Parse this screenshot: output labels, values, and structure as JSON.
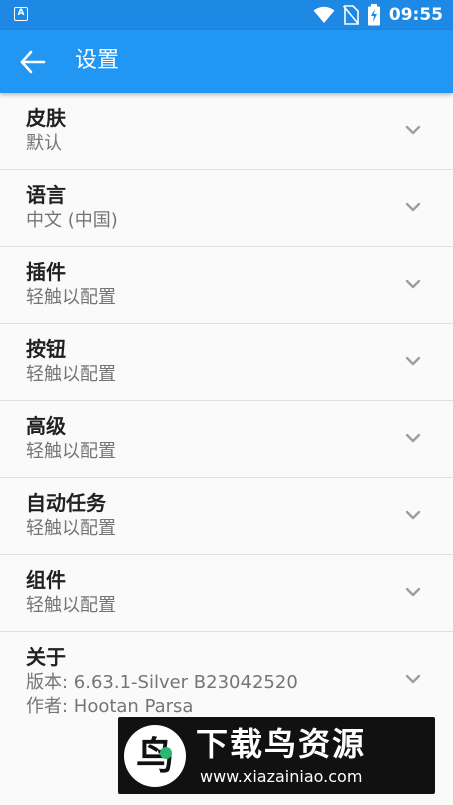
{
  "status_bar": {
    "app_badge": "A",
    "time": "09:55",
    "icons": [
      "wifi-icon",
      "no-sim-icon",
      "battery-charging-icon"
    ]
  },
  "app_bar": {
    "title": "设置",
    "back_icon": "arrow-left-icon"
  },
  "settings": {
    "items": [
      {
        "title": "皮肤",
        "subtitle": "默认"
      },
      {
        "title": "语言",
        "subtitle": "中文 (中国)"
      },
      {
        "title": "插件",
        "subtitle": "轻触以配置"
      },
      {
        "title": "按钮",
        "subtitle": "轻触以配置"
      },
      {
        "title": "高级",
        "subtitle": "轻触以配置"
      },
      {
        "title": "自动任务",
        "subtitle": "轻触以配置"
      },
      {
        "title": "组件",
        "subtitle": "轻触以配置"
      }
    ],
    "about": {
      "title": "关于",
      "version": "版本: 6.63.1-Silver  B23042520",
      "author": "作者: Hootan Parsa"
    },
    "expand_icon": "chevron-down-icon"
  },
  "watermark": {
    "logo_glyph": "鸟",
    "title": "下载鸟资源",
    "url": "www.xiazainiao.com"
  },
  "colors": {
    "status_bar": "#1e88e5",
    "app_bar": "#2196f3",
    "background": "#fafafa",
    "title_text": "#212121",
    "subtitle_text": "#757575"
  }
}
